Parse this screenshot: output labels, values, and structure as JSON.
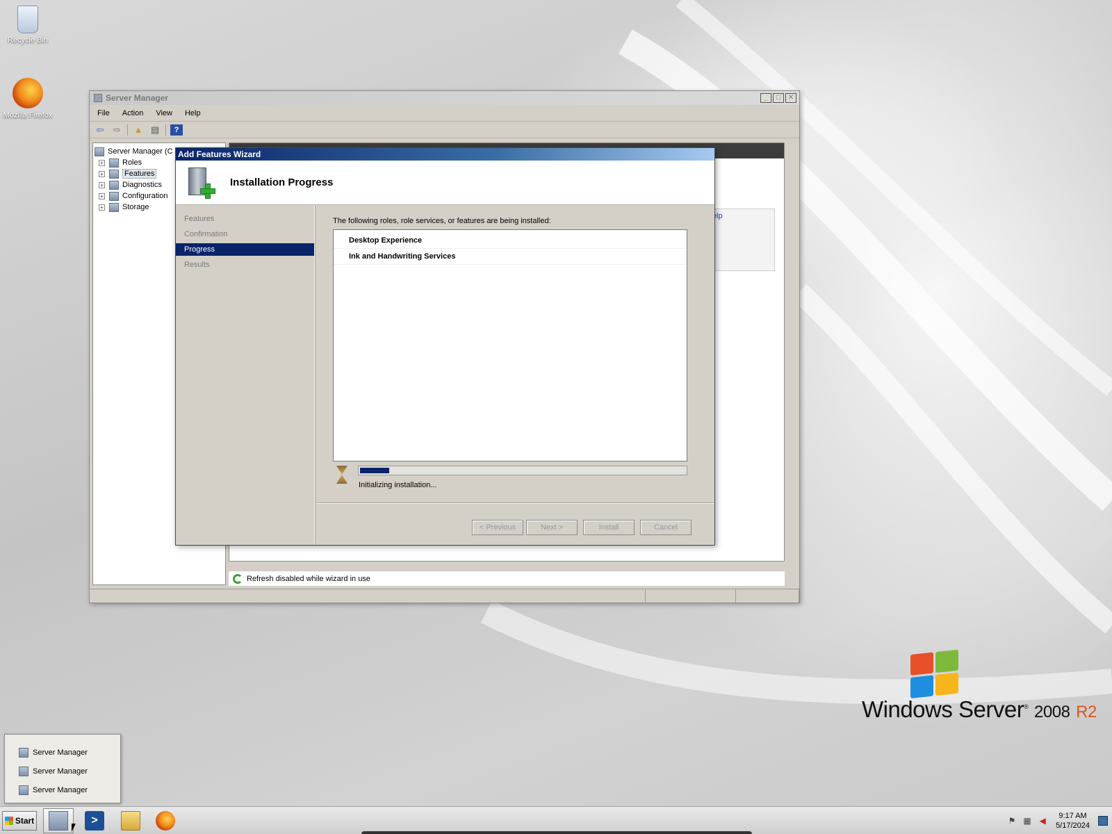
{
  "desktop": {
    "icons": [
      {
        "label": "Recycle Bin",
        "icon": "recycle-bin-icon"
      },
      {
        "label": "Mozilla Firefox",
        "icon": "firefox-icon"
      }
    ]
  },
  "server_manager": {
    "title": "Server Manager",
    "menu": [
      "File",
      "Action",
      "View",
      "Help"
    ],
    "tree": {
      "root": "Server Manager (C",
      "items": [
        "Roles",
        "Features",
        "Diagnostics",
        "Configuration",
        "Storage"
      ],
      "selected": "Features"
    },
    "right_help_link": "Help",
    "status_message": "Refresh disabled while wizard in use"
  },
  "wizard": {
    "title": "Add Features Wizard",
    "header_title": "Installation Progress",
    "nav": [
      "Features",
      "Confirmation",
      "Progress",
      "Results"
    ],
    "active_step": "Progress",
    "description": "The following roles, role services, or features are being installed:",
    "items": [
      "Desktop Experience",
      "Ink and Handwriting Services"
    ],
    "progress_fraction": 0.09,
    "progress_text": "Initializing installation...",
    "buttons": {
      "previous": "< Previous",
      "next": "Next >",
      "install": "Install",
      "cancel": "Cancel"
    }
  },
  "jump_list": {
    "items": [
      "Server Manager",
      "Server Manager",
      "Server Manager"
    ]
  },
  "branding": {
    "product": "Windows Server",
    "version": "2008",
    "edition": "R2"
  },
  "taskbar": {
    "start_label": "Start",
    "apps": [
      "server-manager-icon",
      "powershell-icon",
      "explorer-folder-icon",
      "firefox-icon"
    ],
    "clock_time": "9:17 AM",
    "clock_date": "5/17/2024"
  }
}
